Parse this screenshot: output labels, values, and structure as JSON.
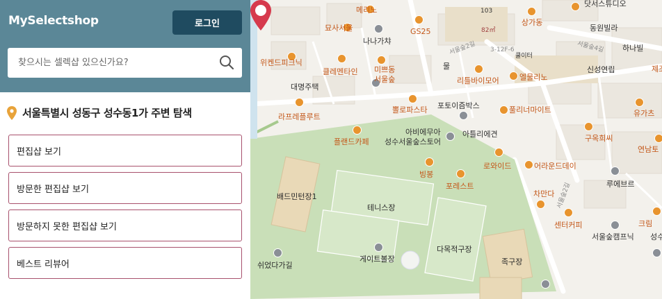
{
  "sidebar": {
    "brand": "MySelectshop",
    "login_label": "로그인",
    "search": {
      "placeholder": "찾으시는 셀렉샵 있으신가요?",
      "value": ""
    },
    "area_title": "서울특별시 성동구 성수동1가 주변 탐색",
    "menu": [
      {
        "label": "편집샵 보기"
      },
      {
        "label": "방문한 편집샵 보기"
      },
      {
        "label": "방문하지 못한 편집샵 보기"
      },
      {
        "label": "베스트 리뷰어"
      }
    ]
  },
  "colors": {
    "header_bg": "#5b8797",
    "login_bg": "#1f4b60",
    "menu_border": "#a8506c",
    "pin": "#e8a33a",
    "marker": "#d63a4d",
    "park": "#c9dfb8"
  },
  "map": {
    "labels": {
      "menu": "메리노",
      "mosa": "묘사서울",
      "nana": "나나가챠",
      "gs25": "GS25",
      "sanga": "상가동",
      "n103": "103",
      "m82": "82㎡",
      "dotsu": "닷서스튜디오",
      "dongwon": "동원빌라",
      "hanil": "하나빌",
      "sinseong": "신성연립",
      "wiken": "위켄드피크닉",
      "clementine": "클레멘타인",
      "mippeum": "미쁘동",
      "seoulsup": "서울숲",
      "mul": "물",
      "ritl": "리틀바이모어",
      "elmuri": "엘물리노",
      "daemyeong": "대명주택",
      "raffr": "라프레플루트",
      "ppolo": "뽈로파스타",
      "photo": "포토이즘박스",
      "pull": "풀리너마이트",
      "yugas": "유가츠",
      "abe": "아비에무아",
      "atl": "아틀리에견",
      "seongsutower": "성수서울숲스토어",
      "flandre": "플랜드카페",
      "guok": "구옥희씨",
      "yeondam": "연남토",
      "lowide": "로와이드",
      "around": "어라운드데이",
      "bingbong": "빙봉",
      "forest": "포레스트",
      "badm": "배드민턴장1",
      "tennis": "테니스장",
      "chamanda": "차만다",
      "luev": "루에브르",
      "center": "센터커피",
      "krim": "크림",
      "camp": "서울숲캠프닉",
      "seongsu": "성수한",
      "multi": "다목적구장",
      "foot": "족구장",
      "gate": "게이트볼장",
      "swing": "쉬었다가길",
      "road1": "서울숲2길",
      "road2": "3-12F-6",
      "road3": "서울숲4길",
      "road4": "서울숲2길",
      "other": "쿨이터",
      "jejeo": "제조"
    }
  }
}
